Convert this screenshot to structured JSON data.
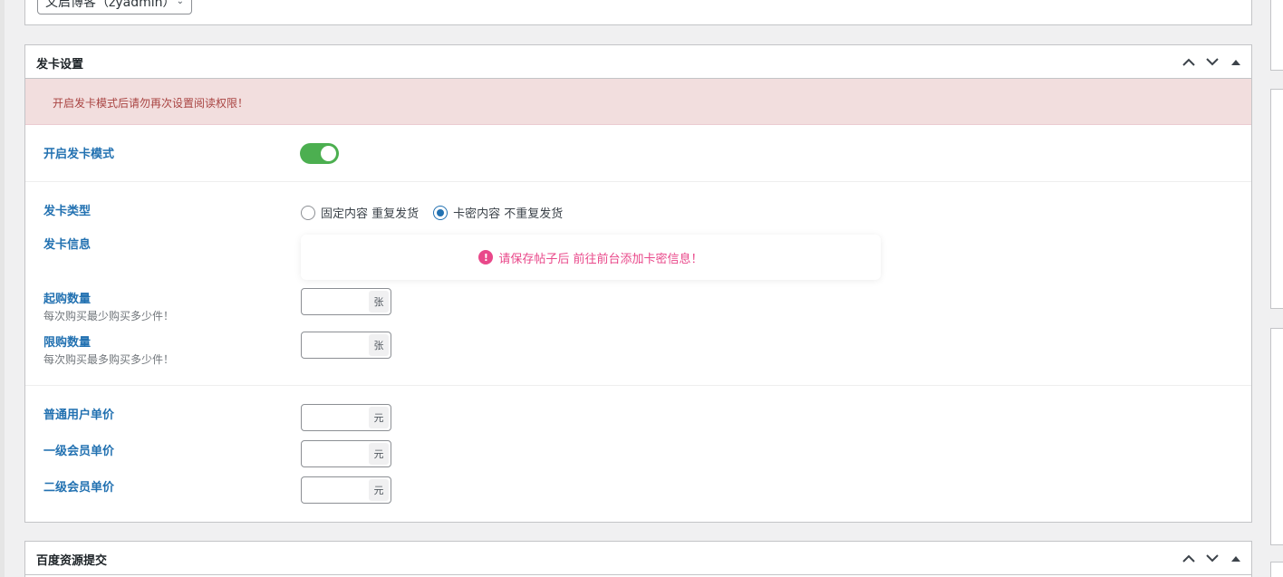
{
  "author_select": {
    "value": "文启博客（zyadmin）"
  },
  "card_box": {
    "title": "发卡设置",
    "notice": "开启发卡模式后请勿再次设置阅读权限！",
    "enable_label": "开启发卡模式",
    "enable_on": true,
    "type_label": "发卡类型",
    "type_options": [
      "固定内容 重复发货",
      "卡密内容 不重复发货"
    ],
    "type_selected": 1,
    "info_label": "发卡信息",
    "info_message": "请保存帖子后 前往前台添加卡密信息！",
    "min_label": "起购数量",
    "min_desc": "每次购买最少购买多少件！",
    "min_unit": "张",
    "max_label": "限购数量",
    "max_desc": "每次购买最多购买多少件！",
    "max_unit": "张",
    "price_normal_label": "普通用户单价",
    "price_vip1_label": "一级会员单价",
    "price_vip2_label": "二级会员单价",
    "price_unit": "元"
  },
  "baidu_box": {
    "title": "百度资源提交"
  },
  "colors": {
    "toggle_on": "#4caf50",
    "notice_bg": "#f2dede",
    "label_blue": "#2271b1",
    "info_pink": "#e9488a"
  }
}
